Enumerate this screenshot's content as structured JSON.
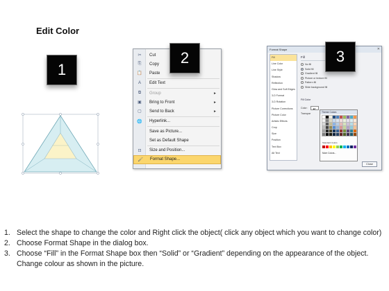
{
  "title": "Edit Color",
  "badges": [
    "1",
    "2",
    "3"
  ],
  "context_menu": {
    "items": [
      {
        "label": "Cut",
        "icon": "scissors-icon",
        "glyph": "✂"
      },
      {
        "label": "Copy",
        "icon": "copy-icon",
        "glyph": "⎘"
      },
      {
        "label": "Paste",
        "icon": "paste-icon",
        "glyph": "📋"
      },
      {
        "label": "Edit Text",
        "icon": "edit-text-icon",
        "glyph": "A"
      },
      {
        "label": "Group",
        "icon": "group-icon",
        "glyph": "⧉",
        "submenu": true,
        "disabled": true
      },
      {
        "label": "Bring to Front",
        "icon": "bring-front-icon",
        "glyph": "▣",
        "submenu": true
      },
      {
        "label": "Send to Back",
        "icon": "send-back-icon",
        "glyph": "▢",
        "submenu": true
      },
      {
        "label": "Hyperlink...",
        "icon": "hyperlink-icon",
        "glyph": "🌐"
      },
      {
        "label": "Save as Picture...",
        "icon": "",
        "glyph": ""
      },
      {
        "label": "Set as Default Shape",
        "icon": "",
        "glyph": ""
      },
      {
        "label": "Size and Position...",
        "icon": "size-icon",
        "glyph": "⊡"
      },
      {
        "label": "Format Shape...",
        "icon": "format-shape-icon",
        "glyph": "🖌",
        "highlighted": true
      }
    ],
    "submenu_glyph": "►"
  },
  "dialog": {
    "title": "Format Shape",
    "close_glyph": "✕",
    "categories": [
      "Fill",
      "Line Color",
      "Line Style",
      "Shadow",
      "Reflection",
      "Glow and Soft Edges",
      "3-D Format",
      "3-D Rotation",
      "Picture Corrections",
      "Picture Color",
      "Artistic Effects",
      "Crop",
      "Size",
      "Position",
      "Text Box",
      "Alt Text"
    ],
    "fill_heading": "Fill",
    "fill_options": [
      {
        "label": "No fill",
        "selected": false
      },
      {
        "label": "Solid fill",
        "selected": true
      },
      {
        "label": "Gradient fill",
        "selected": false
      },
      {
        "label": "Picture or texture fill",
        "selected": false
      },
      {
        "label": "Pattern fill",
        "selected": false
      },
      {
        "label": "Slide background fill",
        "selected": false
      }
    ],
    "fill_color_heading": "Fill Color",
    "color_label": "Color:",
    "transparency_label": "Transpar",
    "palette": {
      "theme_title": "Theme Colors",
      "standard_title": "Standard Colors",
      "more_colors": "More Colors...",
      "theme_top": [
        "#ffffff",
        "#000000",
        "#eeece1",
        "#1f497d",
        "#4f81bd",
        "#c0504d",
        "#9bbb59",
        "#8064a2",
        "#4bacc6",
        "#f79646"
      ],
      "theme_shades": [
        [
          "#f2f2f2",
          "#7f7f7f",
          "#ddd9c3",
          "#c6d9f0",
          "#dbe5f1",
          "#f2dcdb",
          "#ebf1dd",
          "#e5e0ec",
          "#dbeef3",
          "#fdeada"
        ],
        [
          "#d8d8d8",
          "#595959",
          "#c4bd97",
          "#8db3e2",
          "#b8cce4",
          "#e5b9b7",
          "#d7e3bc",
          "#ccc1d9",
          "#b7dde8",
          "#fbd5b5"
        ],
        [
          "#bfbfbf",
          "#3f3f3f",
          "#938953",
          "#548dd4",
          "#95b3d7",
          "#d99694",
          "#c3d69b",
          "#b2a2c7",
          "#92cddc",
          "#fac08f"
        ],
        [
          "#a5a5a5",
          "#262626",
          "#494429",
          "#17365d",
          "#366092",
          "#953734",
          "#76923c",
          "#5f497a",
          "#31859b",
          "#e36c09"
        ],
        [
          "#7f7f7f",
          "#0c0c0c",
          "#1d1b10",
          "#0f243e",
          "#244061",
          "#632423",
          "#4f6128",
          "#3f3151",
          "#205867",
          "#974806"
        ]
      ],
      "standard": [
        "#c00000",
        "#ff0000",
        "#ffc000",
        "#ffff00",
        "#92d050",
        "#00b050",
        "#00b0f0",
        "#0070c0",
        "#002060",
        "#7030a0"
      ]
    },
    "close_label": "Close"
  },
  "instructions": [
    {
      "num": "1.",
      "text": "Select the shape to change the color and Right click the object( click any object which you want to change color)"
    },
    {
      "num": "2.",
      "text": "Choose Format Shape in the dialog box."
    },
    {
      "num": "3.",
      "text": "Choose “Fill” in the Format Shape box then “Solid” or “Gradient” depending on the appearance of the object. Change colour as shown in the picture."
    }
  ]
}
